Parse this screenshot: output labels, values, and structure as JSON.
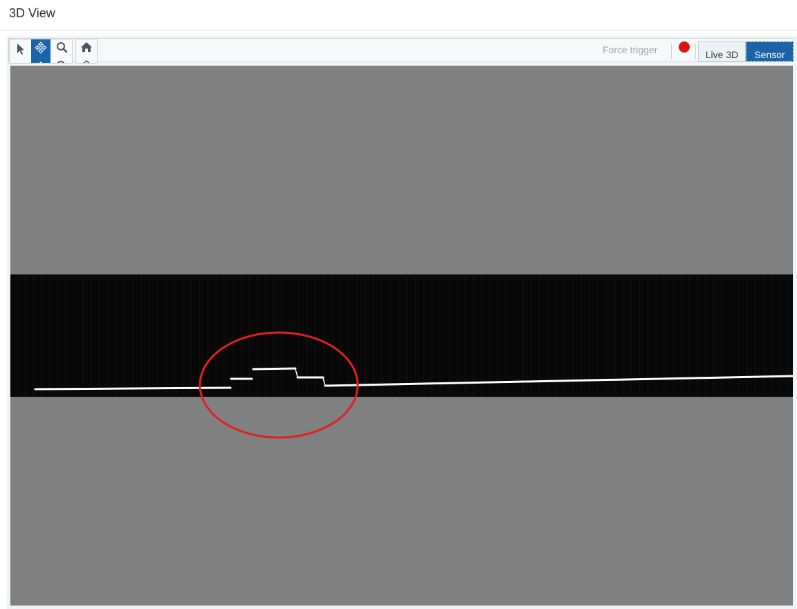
{
  "window": {
    "title": "3D View"
  },
  "toolbar": {
    "tools": [
      {
        "name": "select",
        "icon": "cursor-arrow-icon",
        "active": false
      },
      {
        "name": "pan",
        "icon": "move-arrows-icon",
        "active": true
      },
      {
        "name": "zoom",
        "icon": "magnifier-icon",
        "active": false
      },
      {
        "name": "home",
        "icon": "home-icon",
        "active": false
      }
    ],
    "force_trigger_label": "Force trigger",
    "record_indicator_color": "#e01313",
    "view_modes": [
      {
        "label": "Live 3D",
        "selected": false
      },
      {
        "label": "Sensor",
        "selected": true
      }
    ],
    "accent_color": "#1b64a8"
  },
  "viewport": {
    "background_color": "#808080",
    "scan_band_color": "#080808",
    "profile_line_color": "#ffffff",
    "highlight_circle_color": "#e02020"
  }
}
